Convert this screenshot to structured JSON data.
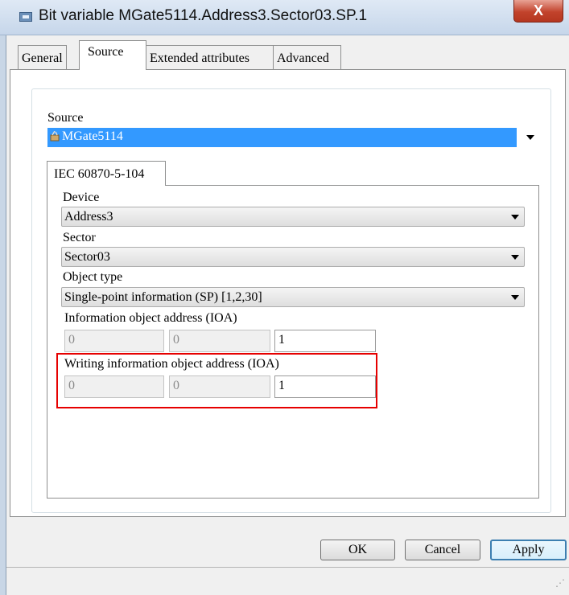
{
  "window": {
    "title": "Bit variable MGate5114.Address3.Sector03.SP.1",
    "close_label": "X"
  },
  "tabs": [
    {
      "label": "General"
    },
    {
      "label": "Source"
    },
    {
      "label": "Extended attributes"
    },
    {
      "label": "Advanced"
    }
  ],
  "active_tab": "Source",
  "source": {
    "label": "Source",
    "value": "MGate5114"
  },
  "protocol_tab": {
    "label": "IEC 60870-5-104"
  },
  "device": {
    "label": "Device",
    "value": "Address3"
  },
  "sector": {
    "label": "Sector",
    "value": "Sector03"
  },
  "object_type": {
    "label": "Object type",
    "value": "Single-point information (SP) [1,2,30]"
  },
  "ioa": {
    "label": "Information object address (IOA)",
    "fields": [
      "0",
      "0",
      "1"
    ]
  },
  "writing_ioa": {
    "label": "Writing information object address (IOA)",
    "fields": [
      "0",
      "0",
      "1"
    ]
  },
  "buttons": {
    "ok": "OK",
    "cancel": "Cancel",
    "apply": "Apply"
  },
  "colors": {
    "selection": "#3399ff",
    "highlight_box": "#e60000",
    "close_button": "#c2432c"
  }
}
